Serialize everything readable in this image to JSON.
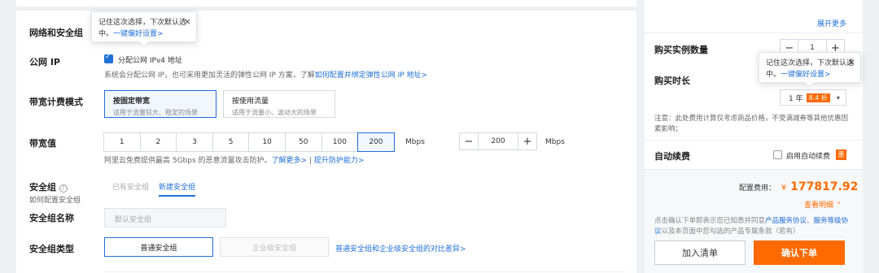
{
  "main": {
    "network_label": "网络和安全组",
    "public_ip": {
      "label": "公网 IP",
      "checkbox_label": "分配公网 IPv4 地址",
      "desc": "系统会分配公网 IP，也可采用更加灵活的弹性公网 IP 方案，了解",
      "link": "如何配置并绑定弹性公网 IP 地址>"
    },
    "bandwidth_billing": {
      "label": "带宽计费模式",
      "options": [
        {
          "title": "按固定带宽",
          "desc": "适用于流量较大、稳定的场景"
        },
        {
          "title": "按使用流量",
          "desc": "适用于流量小、波动大的场景"
        }
      ]
    },
    "bandwidth": {
      "label": "带宽值",
      "options": [
        "1",
        "2",
        "3",
        "5",
        "10",
        "50",
        "100",
        "200"
      ],
      "selected": "200",
      "unit": "Mbps",
      "stepper_value": "200",
      "stepper_unit": "Mbps",
      "desc": "阿里云免费提供最高 5Gbps 的恶意流量攻击防护。",
      "link1": "了解更多>",
      "sep": " | ",
      "link2": "提升防护能力>"
    },
    "security_group": {
      "label": "安全组",
      "sub_label": "如何配置安全组",
      "tab_existing": "已有安全组",
      "tab_new": "新建安全组"
    },
    "sg_name": {
      "label": "安全组名称",
      "placeholder": "默认安全组"
    },
    "sg_type": {
      "label": "安全组类型",
      "normal": "普通安全组",
      "enterprise": "企业级安全组",
      "link": "普通安全组和企业级安全组的对比差异>"
    },
    "tooltip": {
      "text_line1": "记住这次选择，下次默认选",
      "text_line2_prefix": "中。",
      "link": "一键偏好设置>",
      "close": "×"
    }
  },
  "sidebar": {
    "expand_more": "展开更多",
    "quantity": {
      "label": "购买实例数量",
      "value": "1",
      "minus": "−",
      "plus": "+"
    },
    "duration": {
      "label": "购买时长",
      "value": "1 年",
      "discount": "8.4 折",
      "caret": "▾"
    },
    "tooltip": {
      "text_line1": "记住这次选择，下次默认选",
      "text_line2_prefix": "中。",
      "link": "一键偏好设置>",
      "close": "×"
    },
    "note": "注意：此处费用计算仅考虑商品价格，不受满减券等其他优惠因素影响；",
    "auto_renew": {
      "label": "自动续费",
      "checkbox_label": "启用自动续费",
      "badge": "惠"
    },
    "price": {
      "label": "配置费用：",
      "currency": "¥",
      "amount": "177817.92"
    },
    "view_detail": "查看明细",
    "agreement": {
      "part1": "点击确认下单即表示您已知悉并同意",
      "link1": "产品服务协议",
      "part2": "、",
      "link2": "服务等级协议",
      "part3": "以及本页面中您勾选的产品专属条款（若有）"
    },
    "add_to_list": "加入清单",
    "confirm_order": "确认下单"
  },
  "colors": {
    "accent": "#1f6fd8",
    "orange": "#ff6a00"
  }
}
